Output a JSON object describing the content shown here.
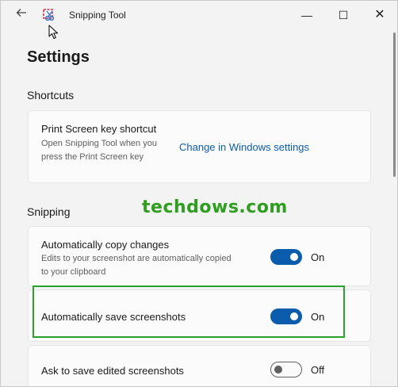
{
  "window": {
    "title": "Snipping Tool",
    "back_icon": "back-arrow-icon",
    "app_icon": "snipping-tool-icon",
    "controls": {
      "minimize": "—",
      "maximize": "☐",
      "close": "✕"
    }
  },
  "page": {
    "title": "Settings"
  },
  "sections": {
    "shortcuts": "Shortcuts",
    "snipping": "Snipping"
  },
  "print_screen": {
    "title": "Print Screen key shortcut",
    "description": "Open Snipping Tool when you press the Print Screen key",
    "link": "Change in Windows settings"
  },
  "copy_changes": {
    "title": "Automatically copy changes",
    "description": "Edits to your screenshot are automatically copied to your clipboard",
    "toggle_state": "On",
    "enabled": true
  },
  "save_screenshots": {
    "title": "Automatically save screenshots",
    "toggle_state": "On",
    "enabled": true
  },
  "ask_save": {
    "title": "Ask to save edited screenshots",
    "toggle_state": "Off",
    "enabled": false
  },
  "watermark": "techdows.com",
  "colors": {
    "accent": "#0b5cad",
    "highlight_border": "#2ca02c",
    "watermark": "#2e9e1f"
  }
}
